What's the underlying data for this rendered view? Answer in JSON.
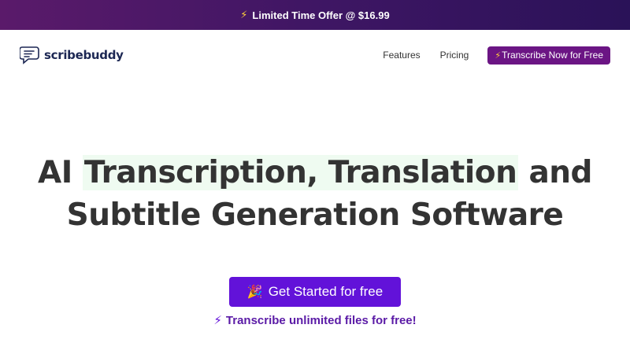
{
  "banner": {
    "icon": "lightning-icon",
    "text": "Limited Time Offer @ $16.99"
  },
  "header": {
    "logo_icon": "chat-bubble-icon",
    "logo_text": "scribebuddy",
    "nav": [
      {
        "label": "Features"
      },
      {
        "label": "Pricing"
      }
    ],
    "cta": {
      "icon": "lightning-icon",
      "label": "Transcribe Now for Free"
    }
  },
  "hero": {
    "title_line1_pre": "AI ",
    "title_line1_highlight": "Transcription, Translation",
    "title_line1_post": " and",
    "title_line2": "Subtitle Generation Software",
    "cta_icon": "party-popper-icon",
    "cta_label": "Get Started for free",
    "sub_icon": "lightning-icon",
    "sub_text": "Transcribe unlimited files for free!"
  },
  "colors": {
    "banner_gradient_start": "#5a1a6a",
    "banner_gradient_end": "#2a1258",
    "nav_cta": "#6b1584",
    "primary_button": "#6212d9",
    "highlight_bg": "#effbf1",
    "subline_text": "#5a1aa6"
  }
}
